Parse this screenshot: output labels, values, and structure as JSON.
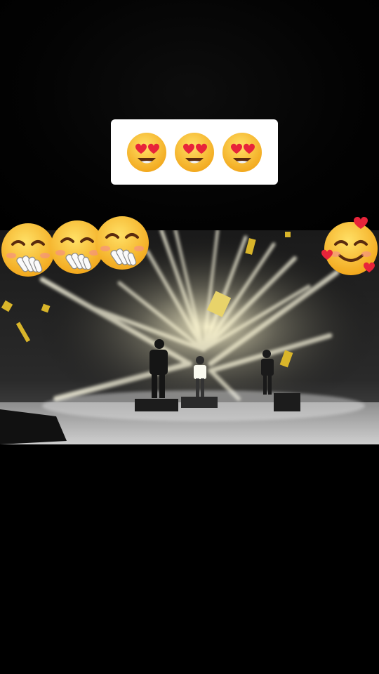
{
  "caption": {
    "emojis": [
      "heart-eyes",
      "heart-eyes",
      "heart-eyes"
    ]
  },
  "overlay": {
    "left_emojis": [
      "blushing-hand-over-mouth",
      "blushing-hand-over-mouth",
      "blushing-hand-over-mouth"
    ],
    "right_emoji": "smiling-face-with-hearts"
  },
  "colors": {
    "background": "#000000",
    "caption_bg": "#ffffff",
    "emoji_yellow": "#f7c531",
    "heart_red": "#e8243a",
    "stage_light": "#f3f0d6",
    "confetti_gold": "#d9b52a"
  }
}
